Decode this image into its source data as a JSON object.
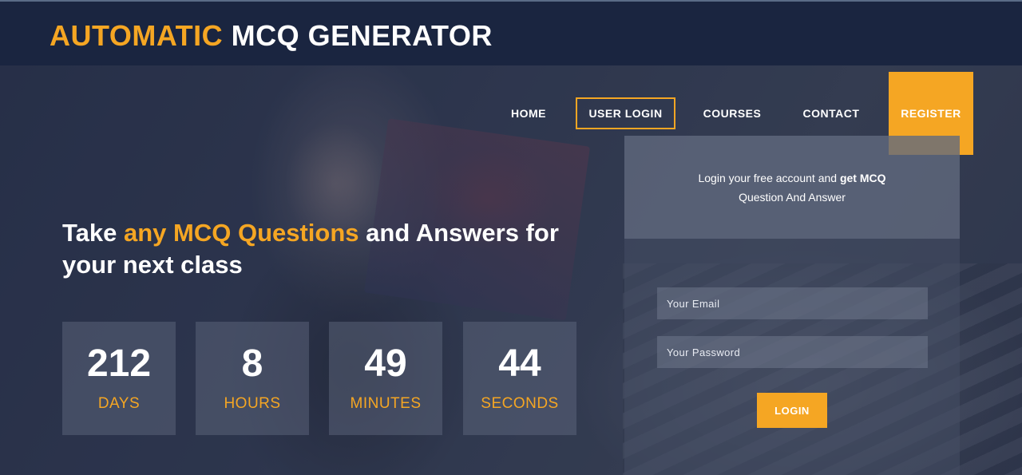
{
  "brand": {
    "accent": "AUTOMATIC",
    "rest": "MCQ GENERATOR"
  },
  "nav": {
    "home": "HOME",
    "user_login": "USER LOGIN",
    "courses": "COURSES",
    "contact": "CONTACT",
    "register": "REGISTER"
  },
  "hero": {
    "headline_start": "Take ",
    "headline_highlight": "any MCQ Questions",
    "headline_end": " and Answers for your next class"
  },
  "countdown": [
    {
      "value": "212",
      "label": "DAYS"
    },
    {
      "value": "8",
      "label": "HOURS"
    },
    {
      "value": "49",
      "label": "MINUTES"
    },
    {
      "value": "44",
      "label": "SECONDS"
    }
  ],
  "login_panel": {
    "intro_plain": "Login your free account and ",
    "intro_bold": "get MCQ",
    "intro_line2": "Question And Answer",
    "email_placeholder": "Your Email",
    "password_placeholder": "Your Password",
    "login_button": "LOGIN"
  },
  "colors": {
    "accent": "#f5a623",
    "header_bg": "#1a2540",
    "text": "#ffffff"
  }
}
